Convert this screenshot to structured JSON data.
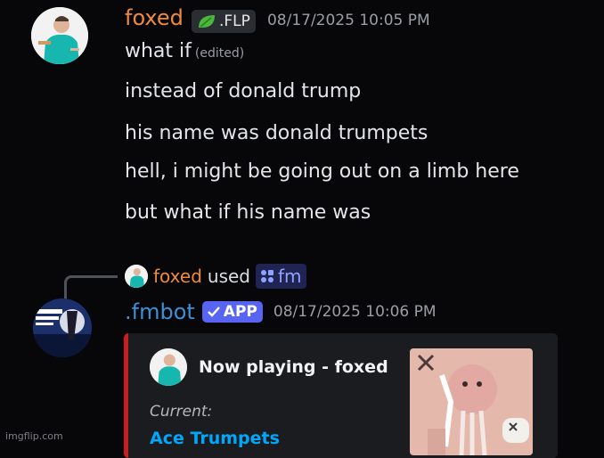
{
  "message1": {
    "author": "foxed",
    "tag_emoji": "leaf-icon",
    "tag": ".FLP",
    "timestamp": "08/17/2025 10:05 PM",
    "first_line": "what if",
    "edited": "(edited)",
    "lines": [
      "instead of donald trump",
      "his name was donald trumpets",
      "hell, i might be going out on a limb here",
      "but what if his name was"
    ]
  },
  "reply": {
    "author": "foxed",
    "verb": "used",
    "command": "fm"
  },
  "message2": {
    "author": ".fmbot",
    "badge": "APP",
    "timestamp": "08/17/2025 10:06 PM",
    "embed": {
      "title": "Now playing - foxed",
      "current_label": "Current:",
      "track": "Ace Trumpets"
    }
  },
  "watermark": "imgflip.com",
  "colors": {
    "accent_orange": "#ef8a3c",
    "bot_blue": "#3d8fd8",
    "app_badge": "#5865f2",
    "embed_bar": "#c81e1e"
  }
}
